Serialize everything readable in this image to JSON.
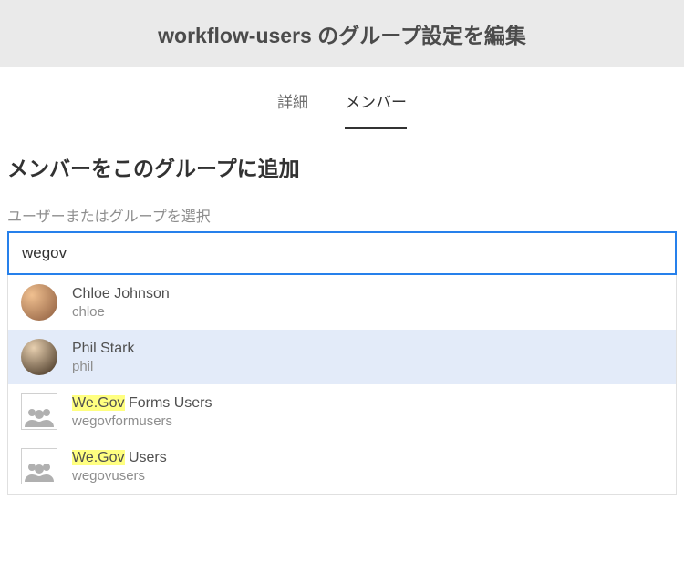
{
  "header": {
    "title": "workflow-users のグループ設定を編集"
  },
  "tabs": {
    "details": "詳細",
    "members": "メンバー",
    "active": "members"
  },
  "section": {
    "title": "メンバーをこのグループに追加",
    "field_label": "ユーザーまたはグループを選択"
  },
  "search": {
    "value": "wegov"
  },
  "results": [
    {
      "name": "Chloe Johnson",
      "sub": "chloe",
      "type": "person",
      "avatar": "person1",
      "highlighted": false,
      "highlight_prefix": ""
    },
    {
      "name": "Phil Stark",
      "sub": "phil",
      "type": "person",
      "avatar": "person2",
      "highlighted": true,
      "highlight_prefix": ""
    },
    {
      "name_prefix": "We.Gov",
      "name_rest": " Forms Users",
      "sub": "wegovformusers",
      "type": "group",
      "highlighted": false
    },
    {
      "name_prefix": "We.Gov",
      "name_rest": " Users",
      "sub": "wegovusers",
      "type": "group",
      "highlighted": false
    }
  ]
}
